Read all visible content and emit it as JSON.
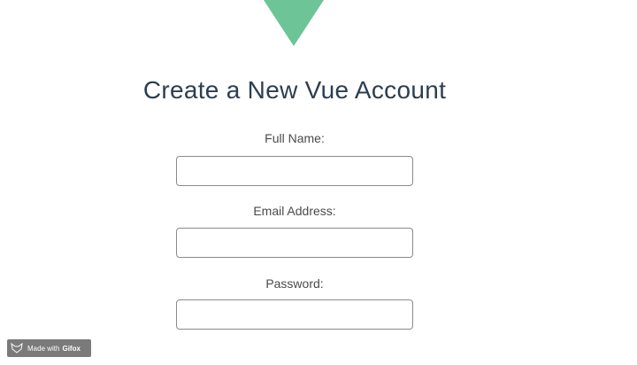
{
  "colors": {
    "logo": "#6cc497",
    "title": "#2c3e50",
    "label": "#4a4a4a",
    "field_border": "#8a8a8a",
    "badge_bg": "#7a7a7a"
  },
  "logo": {
    "icon": "vue-logo-icon"
  },
  "form": {
    "title": "Create a New Vue Account",
    "fields": [
      {
        "label": "Full Name:",
        "value": "",
        "placeholder": ""
      },
      {
        "label": "Email Address:",
        "value": "",
        "placeholder": ""
      },
      {
        "label": "Password:",
        "value": "",
        "placeholder": ""
      }
    ]
  },
  "badge": {
    "icon": "fox-icon",
    "prefix": "Made with",
    "brand": "Gifox"
  }
}
